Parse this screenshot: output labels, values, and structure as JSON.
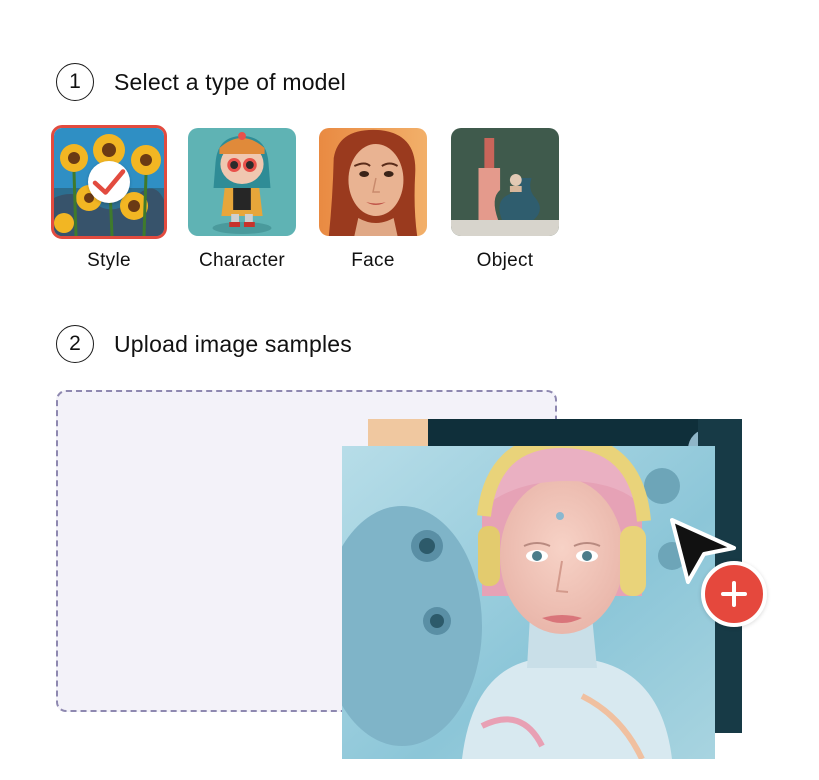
{
  "step1": {
    "number": "1",
    "title": "Select a type of model"
  },
  "model_types": [
    {
      "label": "Style",
      "selected": true
    },
    {
      "label": "Character",
      "selected": false
    },
    {
      "label": "Face",
      "selected": false
    },
    {
      "label": "Object",
      "selected": false
    }
  ],
  "step2": {
    "number": "2",
    "title": "Upload image samples"
  },
  "colors": {
    "selected_border": "#e24b3f",
    "add_button": "#e5483d",
    "dropzone_border": "#8e88b0",
    "dropzone_fill": "#f3f2f9"
  },
  "icons": {
    "check": "check-icon",
    "cursor": "cursor-icon",
    "add": "plus-icon"
  }
}
